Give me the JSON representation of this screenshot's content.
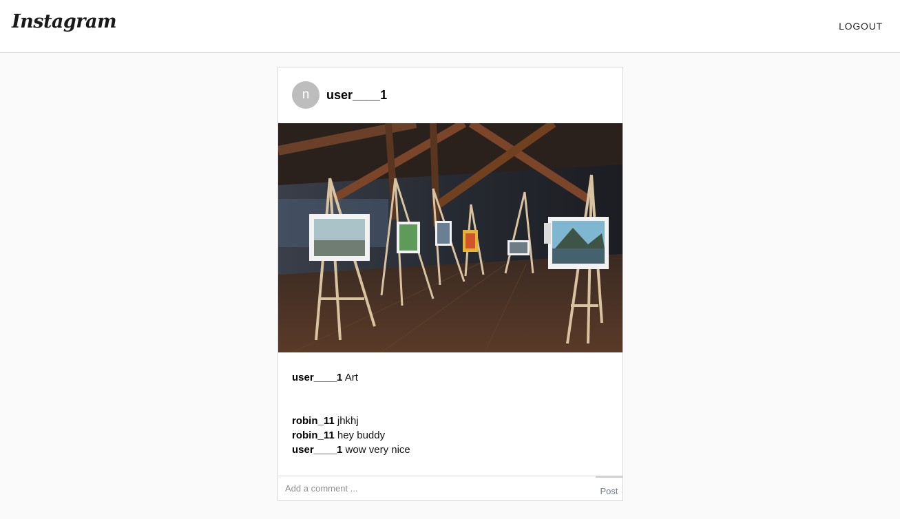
{
  "header": {
    "logo_text": "Instagram",
    "logout_label": "LOGOUT"
  },
  "post": {
    "avatar_letter": "n",
    "username": "user____1",
    "image_alt": "Art easels in a gallery room",
    "caption": {
      "user": "user____1",
      "text": "Art"
    },
    "comments": [
      {
        "user": "robin_11",
        "text": "jhkhj"
      },
      {
        "user": "robin_11",
        "text": "hey buddy"
      },
      {
        "user": "user____1",
        "text": "wow very nice"
      }
    ],
    "comment_placeholder": "Add a comment ...",
    "post_button_label": "Post"
  }
}
